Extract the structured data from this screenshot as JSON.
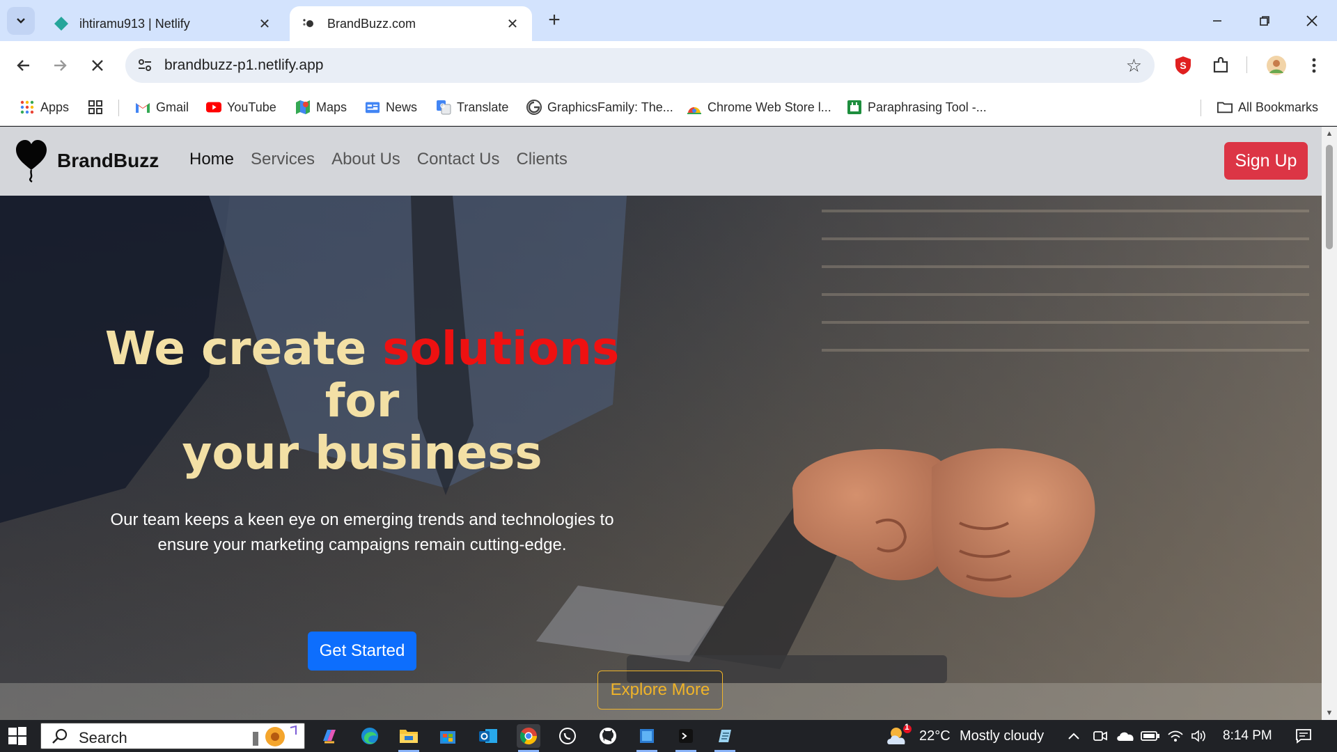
{
  "browser": {
    "tabs": [
      {
        "title": "ihtiramu913 | Netlify",
        "active": false
      },
      {
        "title": "BrandBuzz.com",
        "active": true
      }
    ],
    "url": "brandbuzz-p1.netlify.app",
    "bookmarks": [
      {
        "label": "Apps",
        "icon": "apps-grid-icon"
      },
      {
        "label": "",
        "icon": "tab-groups-icon"
      },
      {
        "label": "Gmail",
        "icon": "gmail-icon"
      },
      {
        "label": "YouTube",
        "icon": "youtube-icon"
      },
      {
        "label": "Maps",
        "icon": "maps-icon"
      },
      {
        "label": "News",
        "icon": "news-icon"
      },
      {
        "label": "Translate",
        "icon": "translate-icon"
      },
      {
        "label": "GraphicsFamily: The...",
        "icon": "graphicsfamily-icon"
      },
      {
        "label": "Chrome Web Store l...",
        "icon": "chrome-web-store-icon"
      },
      {
        "label": "Paraphrasing Tool -...",
        "icon": "paraphrasing-icon"
      }
    ],
    "all_bookmarks": "All Bookmarks"
  },
  "site": {
    "brand": "BrandBuzz",
    "nav": [
      "Home",
      "Services",
      "About Us",
      "Contact Us",
      "Clients"
    ],
    "signup": "Sign Up",
    "hero": {
      "line1_a": "We create ",
      "line1_b": "solutions",
      "line2": "for",
      "line3": "your business",
      "subtitle": "Our team keeps a keen eye on emerging trends and technologies to ensure your marketing campaigns remain cutting-edge.",
      "cta_primary": "Get Started",
      "cta_secondary": "Explore More"
    }
  },
  "taskbar": {
    "search": "Search",
    "weather_temp": "22°C",
    "weather_desc": "Mostly cloudy",
    "weather_badge": "1",
    "time": "8:14 PM"
  },
  "colors": {
    "accent_red": "#dc3545",
    "hero_gold": "#f3e0a5",
    "hero_red": "#ee1111",
    "primary_blue": "#0d6efd",
    "outline_gold": "#f0b429"
  }
}
